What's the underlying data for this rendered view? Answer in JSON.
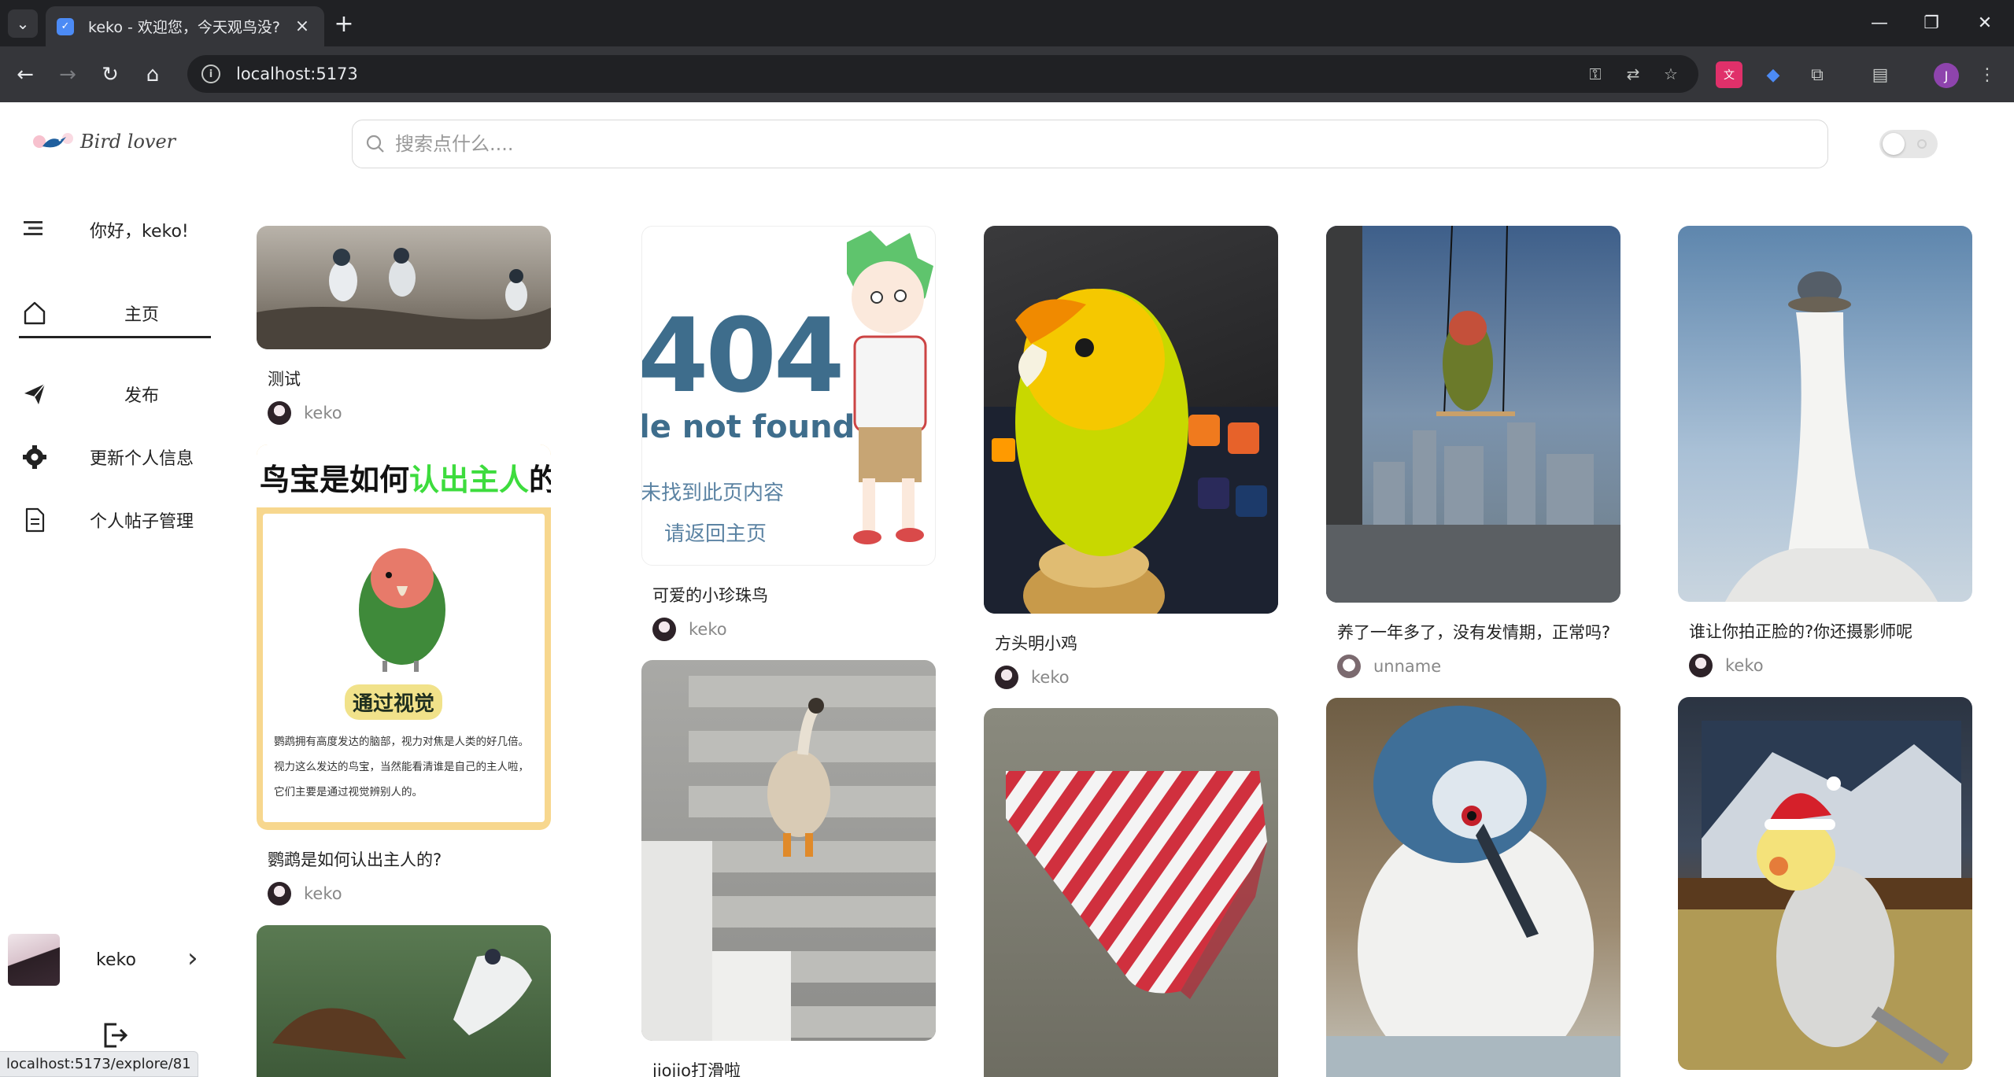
{
  "browser": {
    "tab_title": "keko - 欢迎您，今天观鸟没?",
    "url": "localhost:5173",
    "status_url": "localhost:5173/explore/81",
    "profile_initial": "J"
  },
  "header": {
    "logo_text": "Bird lover",
    "search_placeholder": "搜索点什么....",
    "search_value": ""
  },
  "sidebar": {
    "greeting": "你好，keko!",
    "items": [
      {
        "label": "主页",
        "icon": "home-icon",
        "active": true
      },
      {
        "label": "发布",
        "icon": "send-icon",
        "active": false
      },
      {
        "label": "更新个人信息",
        "icon": "gear-icon",
        "active": false
      },
      {
        "label": "个人帖子管理",
        "icon": "document-icon",
        "active": false
      }
    ],
    "user_name": "keko"
  },
  "feed": {
    "col1": [
      {
        "title": "测试",
        "author": "keko"
      },
      {
        "title": "鹦鹉是如何认出主人的?",
        "author": "keko",
        "img_head_1": "鸟宝是如何",
        "img_head_2": "认出主人",
        "img_head_3": "的",
        "img_badge": "通过视觉",
        "img_body": "鹦鹉拥有高度发达的脑部，视力对焦是人类的好几倍。视力这么发达的鸟宝，当然能看清谁是自己的主人啦，它们主要是通过视觉辨别人的。"
      }
    ],
    "col2": [
      {
        "title": "可爱的小珍珠鸟",
        "author": "keko",
        "img_big": "404",
        "img_sub": "le not found",
        "img_cn_1": "未找到此页内容",
        "img_cn_2": "请返回主页"
      },
      {
        "title": "jiojio打滑啦",
        "author": ""
      }
    ],
    "col3": [
      {
        "title": "方头明小鸡",
        "author": "keko"
      }
    ],
    "col4": [
      {
        "title": "养了一年多了，没有发情期，正常吗?",
        "author": "unname"
      }
    ],
    "col5": [
      {
        "title": "谁让你拍正脸的?你还摄影师呢",
        "author": "keko"
      }
    ]
  },
  "colors": {
    "chrome_dark": "#202124",
    "chrome_mid": "#35363a",
    "card_accent_yellow": "#f7d78e",
    "highlight_green": "#3ddc3d"
  }
}
